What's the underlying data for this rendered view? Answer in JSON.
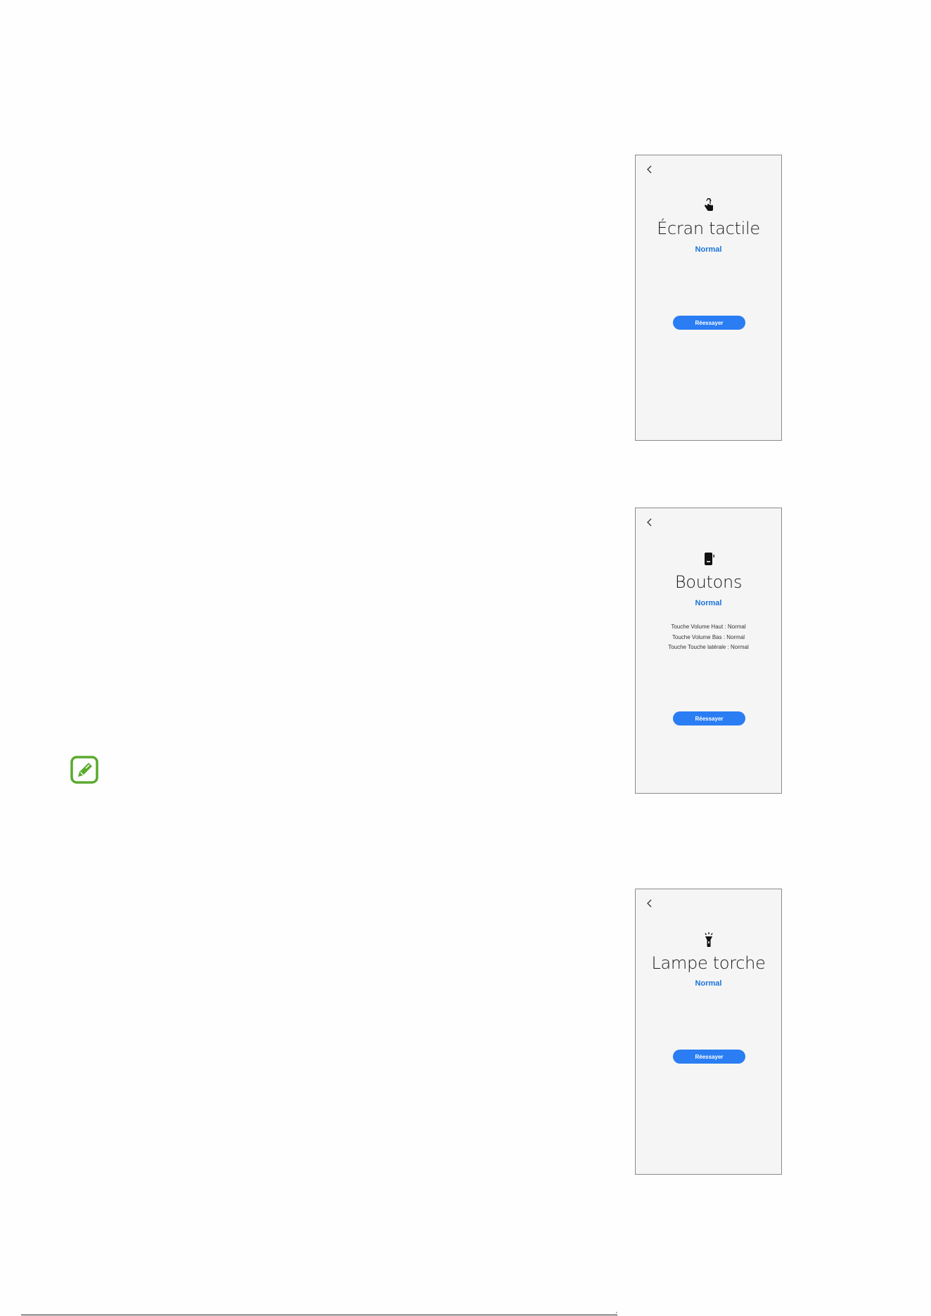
{
  "screens": {
    "touch": {
      "back_icon": "chevron-left",
      "icon": "touch-hand",
      "title": "Écran tactile",
      "status": "Normal",
      "button": "Réessayer"
    },
    "buttons": {
      "back_icon": "chevron-left",
      "icon": "phone-side-button",
      "title": "Boutons",
      "status": "Normal",
      "details": [
        "Touche Volume Haut : Normal",
        "Touche Volume Bas : Normal",
        "Touche Touche latérale : Normal"
      ],
      "button": "Réessayer"
    },
    "torch": {
      "back_icon": "chevron-left",
      "icon": "flashlight",
      "title": "Lampe torche",
      "status": "Normal",
      "button": "Réessayer"
    }
  },
  "note_icon": "note-pencil",
  "colors": {
    "accent": "#2a7df3",
    "status_blue": "#1a73d9",
    "note_green": "#5aaa2e",
    "screen_background": "#f5f5f5"
  }
}
